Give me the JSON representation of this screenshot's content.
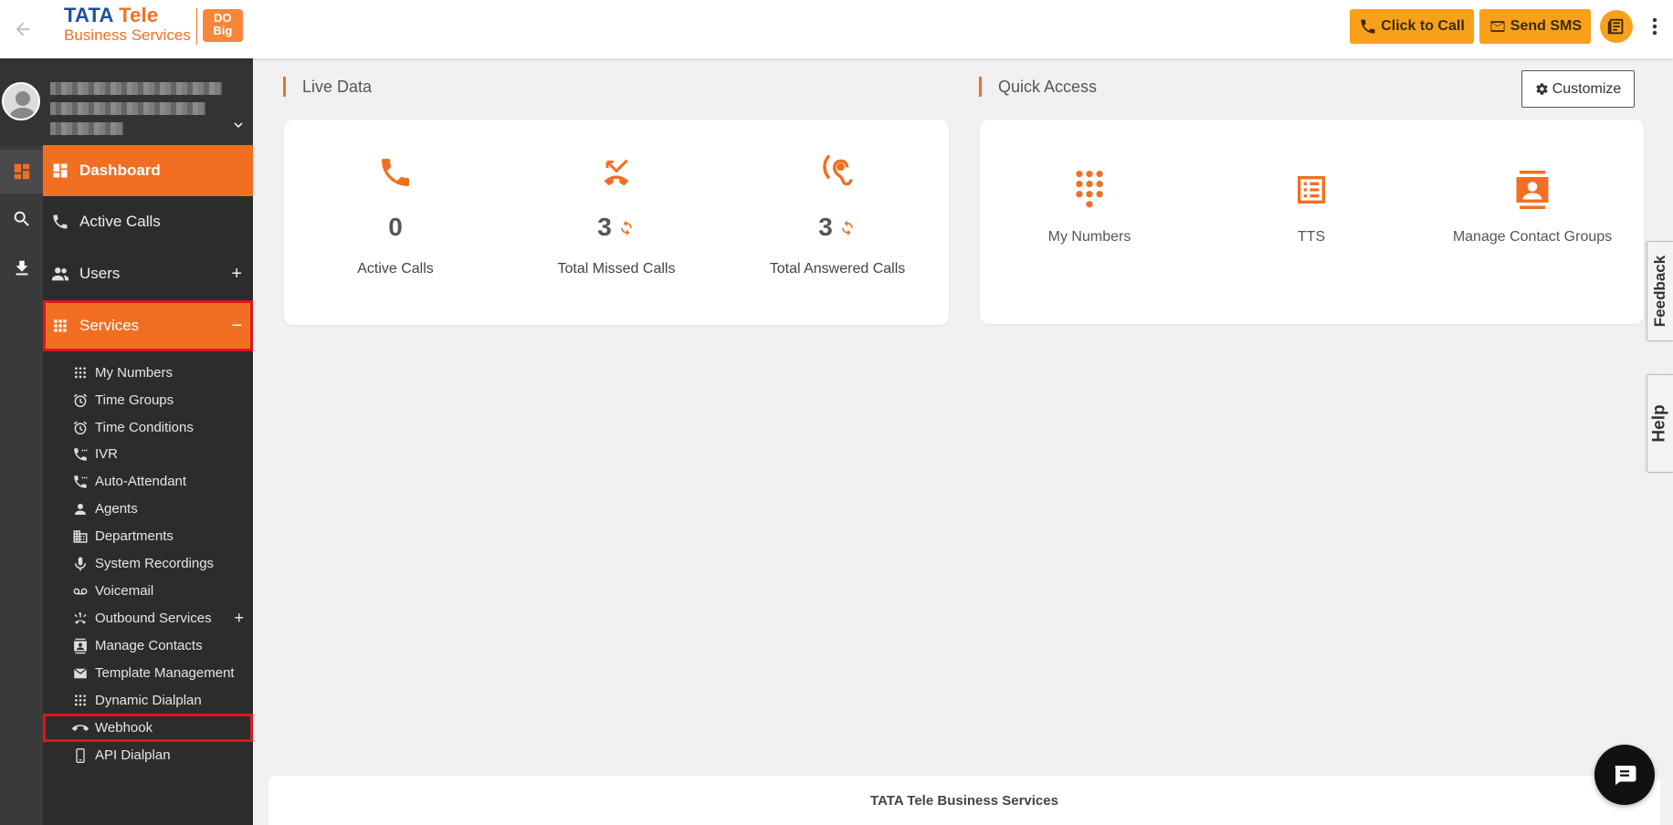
{
  "header": {
    "back_icon": "arrow-left-icon",
    "logo": {
      "line1_a": "TATA",
      "line1_b": "Tele",
      "line2": "Business Services",
      "badge": "DO Big"
    },
    "click_to_call": "Click to Call",
    "send_sms": "Send SMS"
  },
  "rail": {
    "items": [
      "dashboard-icon",
      "search-icon",
      "download-icon"
    ]
  },
  "nav": {
    "dashboard": "Dashboard",
    "active_calls": "Active Calls",
    "users": "Users",
    "services": "Services",
    "plus": "+",
    "minus": "−"
  },
  "services_menu": [
    {
      "label": "My Numbers",
      "icon": "dialpad-icon"
    },
    {
      "label": "Time Groups",
      "icon": "alarm-icon"
    },
    {
      "label": "Time Conditions",
      "icon": "alarm-icon"
    },
    {
      "label": "IVR",
      "icon": "phone-menu-icon"
    },
    {
      "label": "Auto-Attendant",
      "icon": "phone-menu-icon"
    },
    {
      "label": "Agents",
      "icon": "person-icon"
    },
    {
      "label": "Departments",
      "icon": "building-icon"
    },
    {
      "label": "System Recordings",
      "icon": "mic-icon"
    },
    {
      "label": "Voicemail",
      "icon": "voicemail-icon"
    },
    {
      "label": "Outbound Services",
      "icon": "outbound-icon"
    },
    {
      "label": "Manage Contacts",
      "icon": "contacts-icon"
    },
    {
      "label": "Template Management",
      "icon": "mail-icon"
    },
    {
      "label": "Dynamic Dialplan",
      "icon": "dialpad-icon"
    },
    {
      "label": "Webhook",
      "icon": "hangup-icon"
    },
    {
      "label": "API Dialplan",
      "icon": "mobile-icon"
    }
  ],
  "live_data": {
    "title": "Live Data",
    "stats": [
      {
        "label": "Active Calls",
        "value": "0",
        "refresh": false
      },
      {
        "label": "Total Missed Calls",
        "value": "3",
        "refresh": true
      },
      {
        "label": "Total Answered Calls",
        "value": "3",
        "refresh": true
      }
    ]
  },
  "quick_access": {
    "title": "Quick Access",
    "customize": "Customize",
    "items": [
      {
        "label": "My Numbers",
        "icon": "dialpad-icon"
      },
      {
        "label": "TTS",
        "icon": "document-list-icon"
      },
      {
        "label": "Manage Contact Groups",
        "icon": "contacts-icon"
      }
    ]
  },
  "side_tabs": {
    "feedback": "Feedback",
    "help": "Help"
  },
  "footer": {
    "text": "TATA Tele Business Services"
  },
  "colors": {
    "accent": "#f26f21",
    "button": "#f9a01b",
    "sidebar": "#2c2c2c",
    "highlight_outline": "#e0141e"
  }
}
